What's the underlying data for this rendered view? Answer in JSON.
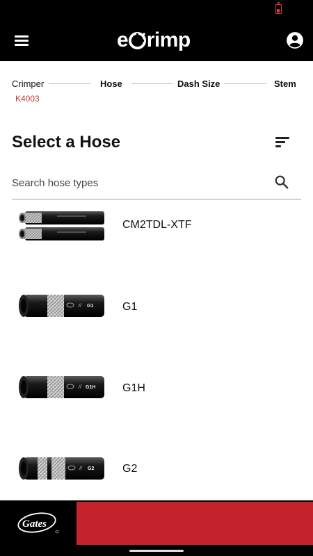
{
  "status_bar": {
    "battery_icon": "battery-charging-icon"
  },
  "app_bar": {
    "logo_text_first": "e",
    "logo_text_rest": "rimp",
    "menu_icon": "menu-icon",
    "account_icon": "account-circle-icon"
  },
  "stepper": {
    "steps": [
      {
        "label": "Crimper"
      },
      {
        "label": "Hose"
      },
      {
        "label": "Dash Size"
      },
      {
        "label": "Stem"
      }
    ],
    "selected_crimper": "K4003"
  },
  "page": {
    "title": "Select a Hose",
    "sort_icon": "sort-icon"
  },
  "search": {
    "placeholder": "Search hose types",
    "value": "",
    "icon": "search-icon"
  },
  "hoses": [
    {
      "name": "CM2TDL-XTF",
      "image": "double-hose-image"
    },
    {
      "name": "G1",
      "image": "hose-image",
      "badge": "G1"
    },
    {
      "name": "G1H",
      "image": "hose-image",
      "badge": "G1H"
    },
    {
      "name": "G2",
      "image": "hose-image",
      "badge": "G2"
    }
  ],
  "footer": {
    "brand": "Gates",
    "colors": {
      "accent": "#c4232b",
      "background": "#000000"
    }
  }
}
